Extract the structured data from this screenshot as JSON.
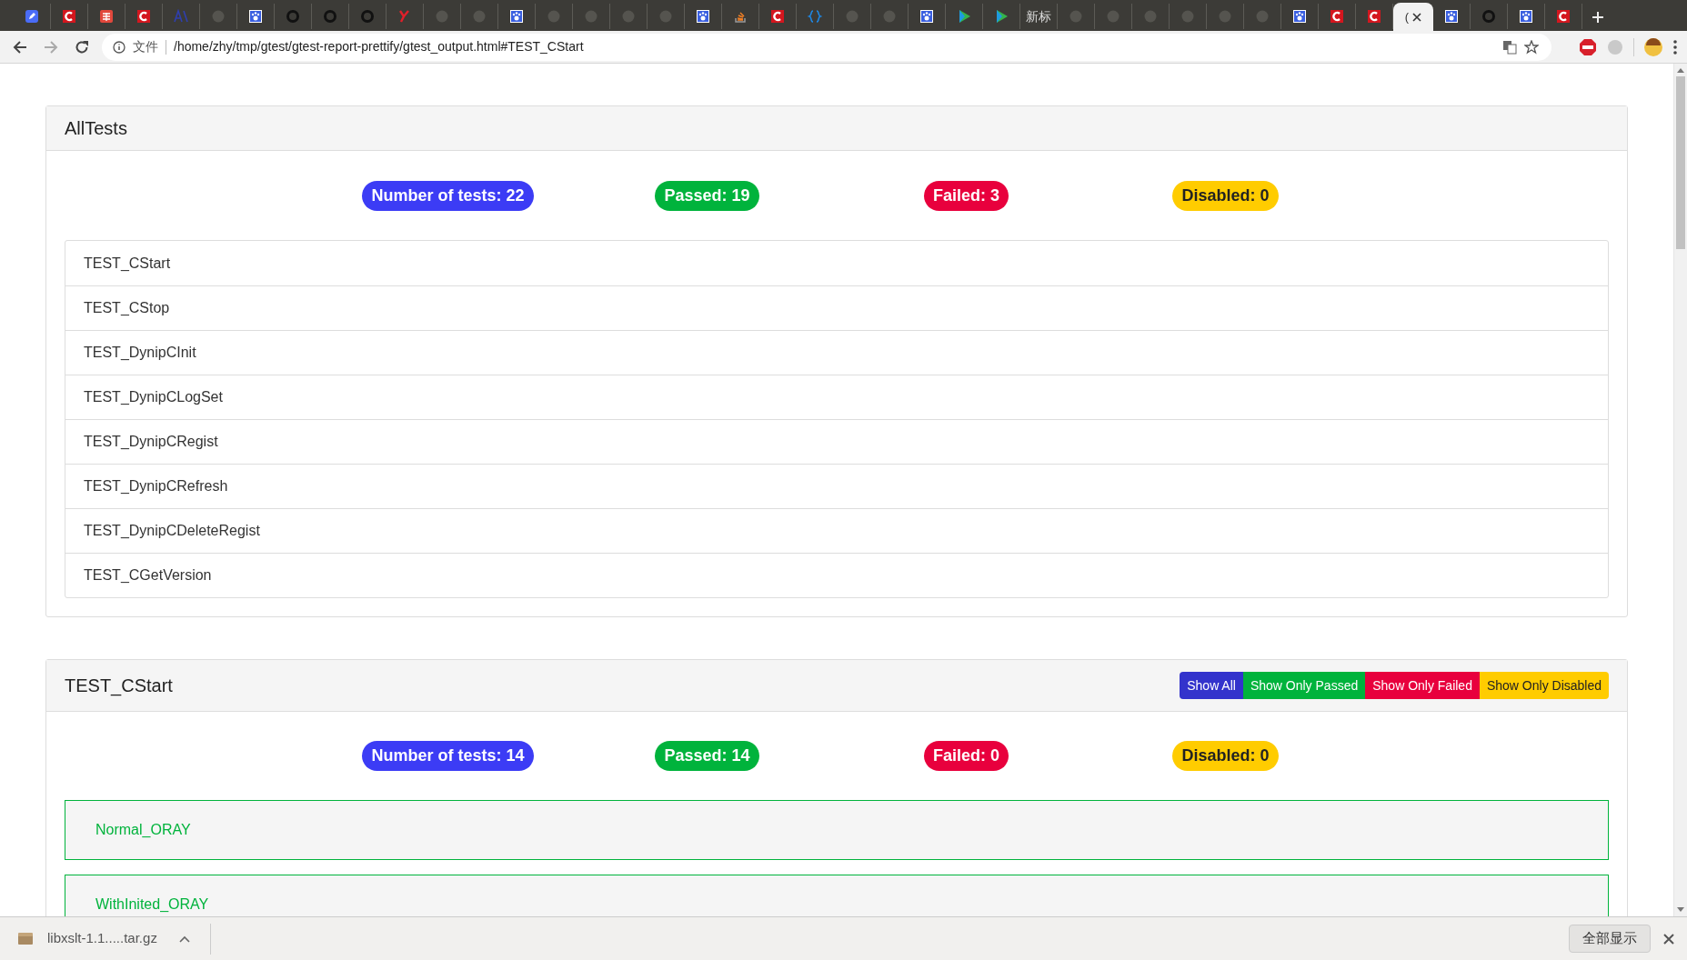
{
  "browser": {
    "tabs": [
      {
        "kind": "edit",
        "selected": false
      },
      {
        "kind": "c",
        "selected": false
      },
      {
        "kind": "jian",
        "selected": false
      },
      {
        "kind": "c",
        "selected": false
      },
      {
        "kind": "ai",
        "selected": false
      },
      {
        "kind": "globe",
        "selected": false
      },
      {
        "kind": "paw",
        "selected": false
      },
      {
        "kind": "cat",
        "selected": false
      },
      {
        "kind": "cat",
        "selected": false
      },
      {
        "kind": "cat",
        "selected": false
      },
      {
        "kind": "y",
        "selected": false
      },
      {
        "kind": "globe",
        "selected": false
      },
      {
        "kind": "globe",
        "selected": false
      },
      {
        "kind": "paw",
        "selected": false
      },
      {
        "kind": "globe",
        "selected": false
      },
      {
        "kind": "globe",
        "selected": false
      },
      {
        "kind": "globe",
        "selected": false
      },
      {
        "kind": "globe",
        "selected": false
      },
      {
        "kind": "paw",
        "selected": false
      },
      {
        "kind": "stack",
        "selected": false
      },
      {
        "kind": "c",
        "selected": false
      },
      {
        "kind": "braces",
        "selected": false
      },
      {
        "kind": "globe",
        "selected": false
      },
      {
        "kind": "globe",
        "selected": false
      },
      {
        "kind": "paw",
        "selected": false
      },
      {
        "kind": "play",
        "selected": false
      },
      {
        "kind": "play",
        "selected": false
      },
      {
        "kind": "none",
        "title": "新标",
        "selected": false
      },
      {
        "kind": "globe",
        "selected": false
      },
      {
        "kind": "globe",
        "selected": false
      },
      {
        "kind": "globe",
        "selected": false
      },
      {
        "kind": "globe",
        "selected": false
      },
      {
        "kind": "globe",
        "selected": false
      },
      {
        "kind": "globe",
        "selected": false
      },
      {
        "kind": "paw",
        "selected": false
      },
      {
        "kind": "c",
        "selected": false
      },
      {
        "kind": "c",
        "selected": false
      },
      {
        "kind": "none",
        "title": "(",
        "selected": true
      },
      {
        "kind": "paw",
        "selected": false
      },
      {
        "kind": "cat",
        "selected": false
      },
      {
        "kind": "paw",
        "selected": false
      },
      {
        "kind": "c",
        "selected": false
      }
    ],
    "address": {
      "security_label": "文件",
      "url": "/home/zhy/tmp/gtest/gtest-report-prettify/gtest_output.html#TEST_CStart"
    }
  },
  "summary": {
    "title": "AllTests",
    "stats": [
      {
        "kind": "total",
        "label": "Number of tests: 22"
      },
      {
        "kind": "passed",
        "label": "Passed: 19"
      },
      {
        "kind": "failed",
        "label": "Failed: 3"
      },
      {
        "kind": "disabled",
        "label": "Disabled: 0"
      }
    ],
    "tests": [
      "TEST_CStart",
      "TEST_CStop",
      "TEST_DynipCInit",
      "TEST_DynipCLogSet",
      "TEST_DynipCRegist",
      "TEST_DynipCRefresh",
      "TEST_DynipCDeleteRegist",
      "TEST_CGetVersion"
    ]
  },
  "suite": {
    "title": "TEST_CStart",
    "filters": [
      {
        "kind": "total",
        "label": "Show All"
      },
      {
        "kind": "passed",
        "label": "Show Only Passed"
      },
      {
        "kind": "failed",
        "label": "Show Only Failed"
      },
      {
        "kind": "disabled",
        "label": "Show Only Disabled"
      }
    ],
    "stats": [
      {
        "kind": "total",
        "label": "Number of tests: 14"
      },
      {
        "kind": "passed",
        "label": "Passed: 14"
      },
      {
        "kind": "failed",
        "label": "Failed: 0"
      },
      {
        "kind": "disabled",
        "label": "Disabled: 0"
      }
    ],
    "cases": [
      {
        "name": "Normal_ORAY",
        "kind": "passed"
      },
      {
        "name": "WithInited_ORAY",
        "kind": "passed"
      }
    ]
  },
  "download_bar": {
    "file": "libxslt-1.1.....tar.gz",
    "show_all": "全部显示"
  }
}
